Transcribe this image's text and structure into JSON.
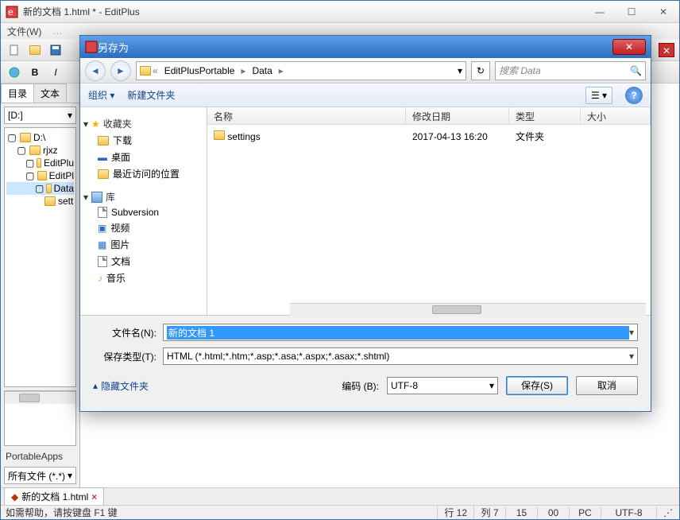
{
  "main": {
    "title": "新的文档 1.html * - EditPlus",
    "menus": [
      "文件(W)"
    ],
    "side_tabs": {
      "active": "目录",
      "inactive": "文本"
    },
    "drive": "[D:]",
    "tree": {
      "root": "D:\\",
      "n1": "rjxz",
      "n2": "EditPlu",
      "n3": "EditPl",
      "n4": "Data",
      "n5": "sett"
    },
    "filter": "所有文件 (*.*)",
    "portable_label": "PortableApps",
    "doc_tab": "新的文档 1.html",
    "status": {
      "help": "如需帮助，请按键盘 F1 键",
      "line": "行 12",
      "col": "列 7",
      "sel": "15",
      "ins": "00",
      "mode": "PC",
      "enc": "UTF-8"
    }
  },
  "dialog": {
    "title": "另存为",
    "breadcrumb": {
      "p1": "EditPlusPortable",
      "p2": "Data"
    },
    "search_placeholder": "搜索 Data",
    "toolbar": {
      "organize": "组织",
      "newfolder": "新建文件夹"
    },
    "tree": {
      "fav": "收藏夹",
      "downloads": "下载",
      "desktop": "桌面",
      "recent": "最近访问的位置",
      "lib": "库",
      "subversion": "Subversion",
      "video": "视频",
      "pictures": "图片",
      "docs": "文档",
      "music": "音乐"
    },
    "columns": {
      "name": "名称",
      "date": "修改日期",
      "type": "类型",
      "size": "大小"
    },
    "row": {
      "name": "settings",
      "date": "2017-04-13 16:20",
      "type": "文件夹"
    },
    "labels": {
      "filename": "文件名(N):",
      "savetype": "保存类型(T):",
      "encoding": "编码 (B):",
      "hide": "隐藏文件夹"
    },
    "values": {
      "filename": "新的文档 1",
      "savetype": "HTML (*.html;*.htm;*.asp;*.asa;*.aspx;*.asax;*.shtml)",
      "encoding": "UTF-8"
    },
    "buttons": {
      "save": "保存(S)",
      "cancel": "取消"
    }
  }
}
